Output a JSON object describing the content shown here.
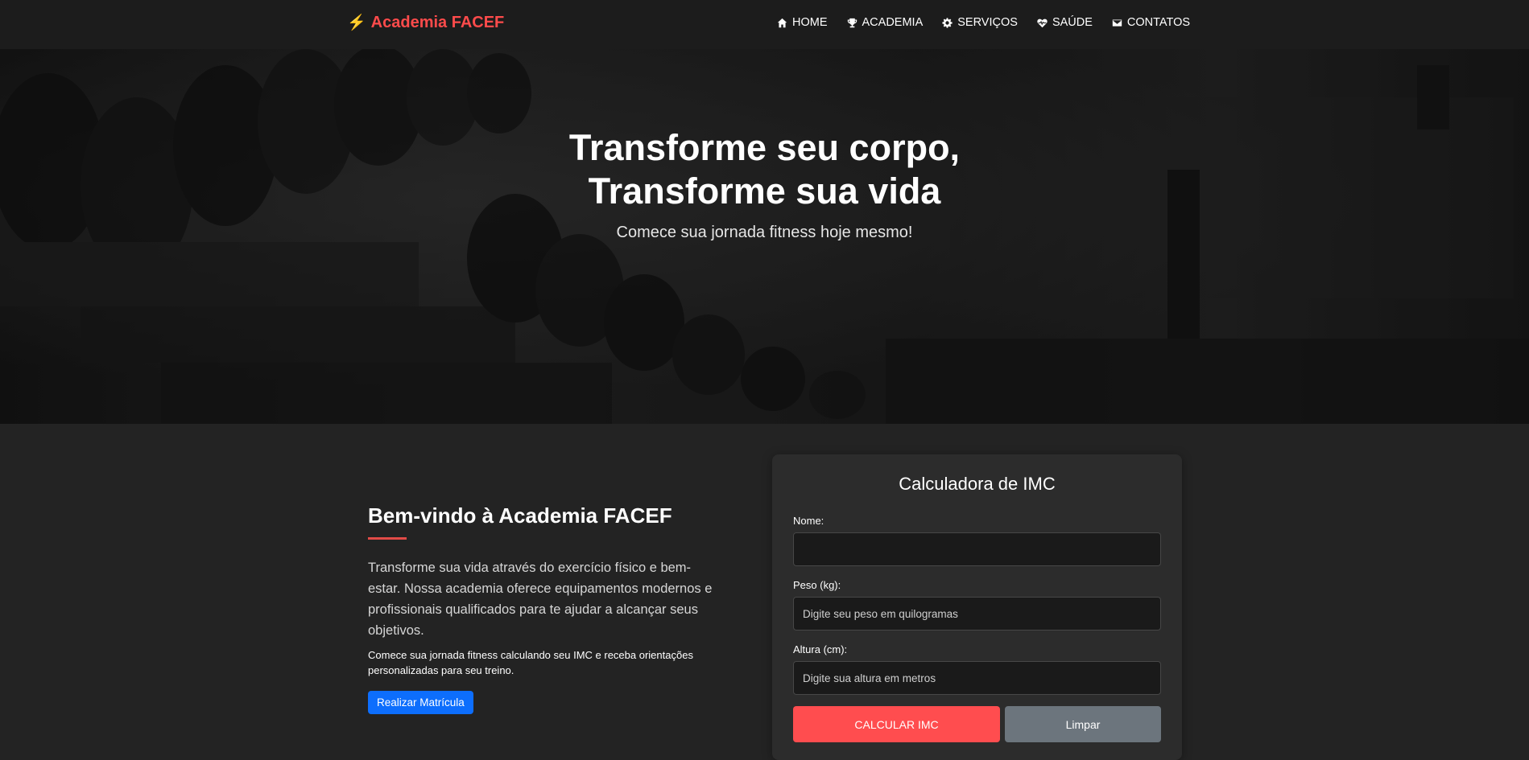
{
  "brand": {
    "icon": "lightning-bolt-icon",
    "name": "Academia FACEF"
  },
  "nav": [
    {
      "icon": "home-icon",
      "label": "HOME"
    },
    {
      "icon": "trophy-icon",
      "label": "ACADEMIA"
    },
    {
      "icon": "gear-icon",
      "label": "SERVIÇOS"
    },
    {
      "icon": "heart-pulse-icon",
      "label": "SAÚDE"
    },
    {
      "icon": "envelope-icon",
      "label": "CONTATOS"
    }
  ],
  "hero": {
    "title_line1": "Transforme seu corpo,",
    "title_line2": "Transforme sua vida",
    "subtitle": "Comece sua jornada fitness hoje mesmo!"
  },
  "welcome": {
    "title": "Bem-vindo à Academia FACEF",
    "text": "Transforme sua vida através do exercício físico e bem-estar. Nossa academia oferece equipamentos modernos e profissionais qualificados para te ajudar a alcançar seus objetivos.",
    "small_text": "Comece sua jornada fitness calculando seu IMC e receba orientações personalizadas para seu treino.",
    "button": "Realizar Matrícula"
  },
  "imc": {
    "title": "Calculadora de IMC",
    "name_label": "Nome:",
    "name_value": "",
    "weight_label": "Peso (kg):",
    "weight_placeholder": "Digite seu peso em quilogramas",
    "height_label": "Altura (cm):",
    "height_placeholder": "Digite sua altura em metros",
    "calc_button": "CALCULAR IMC",
    "clear_button": "Limpar"
  },
  "colors": {
    "accent": "#ff4d4f",
    "primary_button": "#0d6efd",
    "secondary_button": "#6c757d",
    "background": "#232323"
  }
}
